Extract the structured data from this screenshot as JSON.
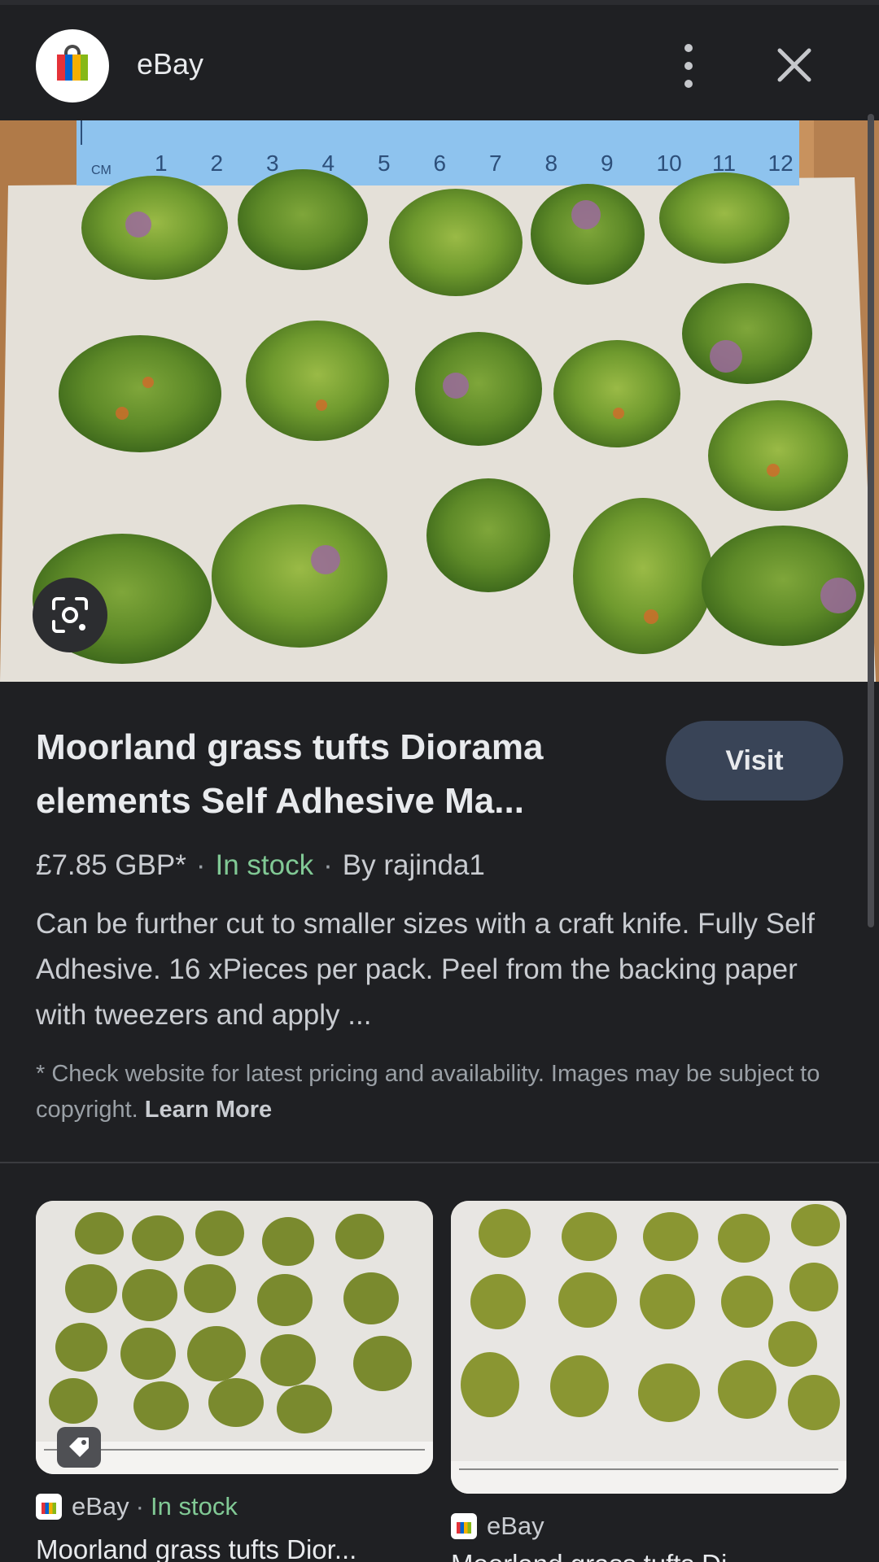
{
  "header": {
    "app_name": "eBay",
    "app_icon": "ebay-shopping-bag-icon",
    "more_icon": "more-vert-icon",
    "close_icon": "close-icon"
  },
  "main_image": {
    "ruler_unit": "CM",
    "ruler_numbers": [
      "1",
      "2",
      "3",
      "4",
      "5",
      "6",
      "7",
      "8",
      "9",
      "10",
      "11",
      "12"
    ],
    "lens_icon": "lens-search-icon"
  },
  "result": {
    "title": "Moorland grass tufts Diorama elements Self Adhesive Ma...",
    "visit_label": "Visit",
    "price": "£7.85 GBP*",
    "stock": "In stock",
    "seller": "By rajinda1",
    "description": "Can be further cut to smaller sizes with a craft knife. Fully Self Adhesive. 16 xPieces per pack. Peel from the backing paper with tweezers and apply ...",
    "disclaimer": "* Check website for latest pricing and availability. Images may be subject to copyright.",
    "learn_more": "Learn More"
  },
  "related": [
    {
      "source": "eBay",
      "stock": "In stock",
      "title": "Moorland grass tufts Dior...",
      "tag_icon": "price-tag-icon"
    },
    {
      "source": "eBay",
      "title": "Moorland grass tufts Di..."
    }
  ],
  "colors": {
    "background": "#1f2023",
    "accent_button": "#394457",
    "in_stock": "#81c995",
    "ruler_blue": "#7eb6e8"
  }
}
